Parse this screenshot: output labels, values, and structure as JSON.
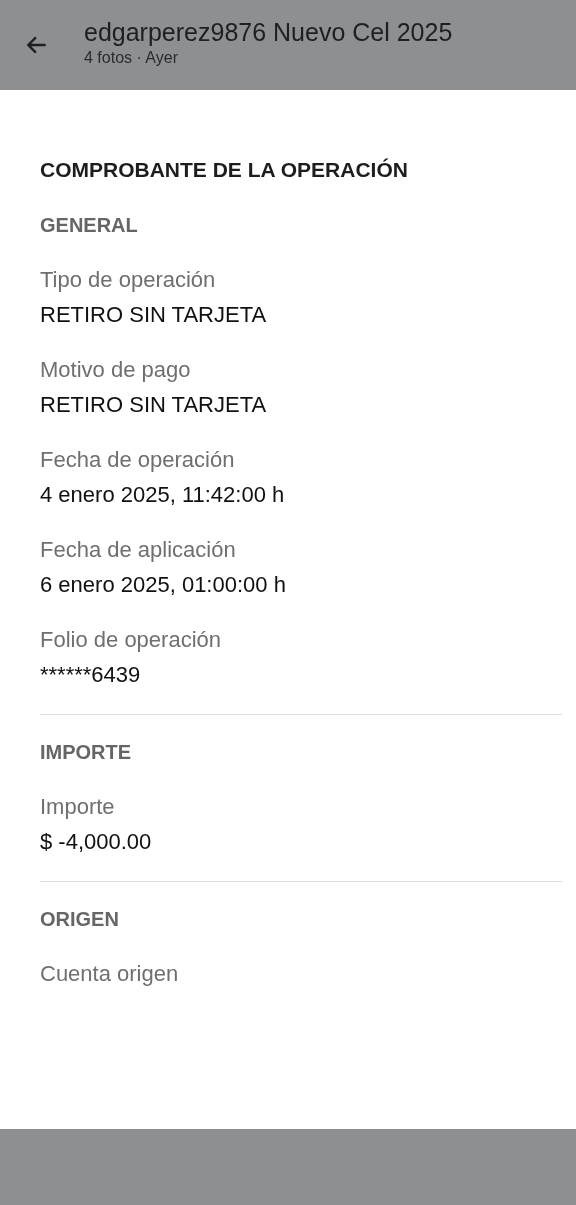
{
  "header": {
    "title": "edgarperez9876 Nuevo Cel 2025",
    "subtitle": "4 fotos · Ayer"
  },
  "receipt": {
    "title": "COMPROBANTE DE LA OPERACIÓN",
    "sections": [
      {
        "heading": "GENERAL",
        "fields": [
          {
            "label": "Tipo de operación",
            "value": "RETIRO SIN TARJETA"
          },
          {
            "label": "Motivo de pago",
            "value": "RETIRO SIN TARJETA"
          },
          {
            "label": "Fecha de operación",
            "value": "4 enero 2025, 11:42:00 h"
          },
          {
            "label": "Fecha de aplicación",
            "value": "6 enero 2025, 01:00:00 h"
          },
          {
            "label": "Folio de operación",
            "value": "******6439"
          }
        ]
      },
      {
        "heading": "IMPORTE",
        "fields": [
          {
            "label": "Importe",
            "value": "$ -4,000.00"
          }
        ]
      },
      {
        "heading": "ORIGEN",
        "fields": [
          {
            "label": "Cuenta origen"
          }
        ]
      }
    ]
  }
}
